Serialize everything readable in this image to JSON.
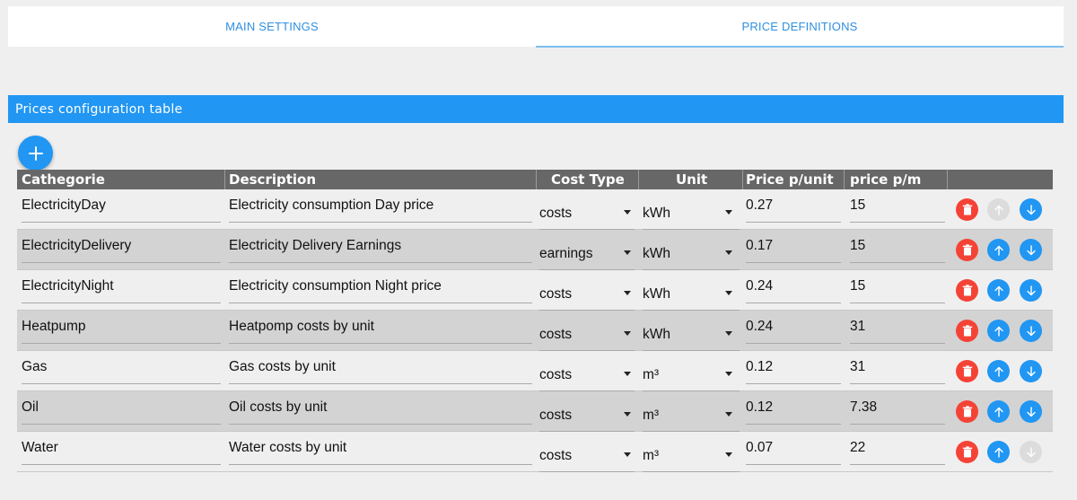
{
  "tabs": [
    {
      "label": "MAIN SETTINGS",
      "active": false
    },
    {
      "label": "PRICE DEFINITIONS",
      "active": true
    }
  ],
  "panel": {
    "title": "Prices configuration table"
  },
  "colors": {
    "accent": "#2196f3",
    "delete": "#f44336",
    "header": "#676767",
    "disabled": "#dcdcdc"
  },
  "icons": {
    "add": "plus-icon",
    "delete": "trash-icon",
    "up": "arrow-up-icon",
    "down": "arrow-down-icon",
    "dropdown": "caret-down-icon"
  },
  "table": {
    "headers": {
      "category": "Cathegorie",
      "description": "Description",
      "cost_type": "Cost Type",
      "unit": "Unit",
      "price_unit": "Price p/unit",
      "price_month": "price p/m"
    },
    "rows": [
      {
        "category": "ElectricityDay",
        "description": "Electricity consumption Day price",
        "cost_type": "costs",
        "unit": "kWh",
        "price_unit": "0.27",
        "price_month": "15",
        "up_enabled": false,
        "down_enabled": true
      },
      {
        "category": "ElectricityDelivery",
        "description": "Electricity Delivery Earnings",
        "cost_type": "earnings",
        "unit": "kWh",
        "price_unit": "0.17",
        "price_month": "15",
        "up_enabled": true,
        "down_enabled": true
      },
      {
        "category": "ElectricityNight",
        "description": "Electricity consumption Night price",
        "cost_type": "costs",
        "unit": "kWh",
        "price_unit": "0.24",
        "price_month": "15",
        "up_enabled": true,
        "down_enabled": true
      },
      {
        "category": "Heatpump",
        "description": "Heatpomp costs by unit",
        "cost_type": "costs",
        "unit": "kWh",
        "price_unit": "0.24",
        "price_month": "31",
        "up_enabled": true,
        "down_enabled": true
      },
      {
        "category": "Gas",
        "description": "Gas costs by unit",
        "cost_type": "costs",
        "unit": "m³",
        "price_unit": "0.12",
        "price_month": "31",
        "up_enabled": true,
        "down_enabled": true
      },
      {
        "category": "Oil",
        "description": "Oil costs by unit",
        "cost_type": "costs",
        "unit": "m³",
        "price_unit": "0.12",
        "price_month": "7.38",
        "up_enabled": true,
        "down_enabled": true
      },
      {
        "category": "Water",
        "description": "Water costs by unit",
        "cost_type": "costs",
        "unit": "m³",
        "price_unit": "0.07",
        "price_month": "22",
        "up_enabled": true,
        "down_enabled": false
      }
    ]
  }
}
